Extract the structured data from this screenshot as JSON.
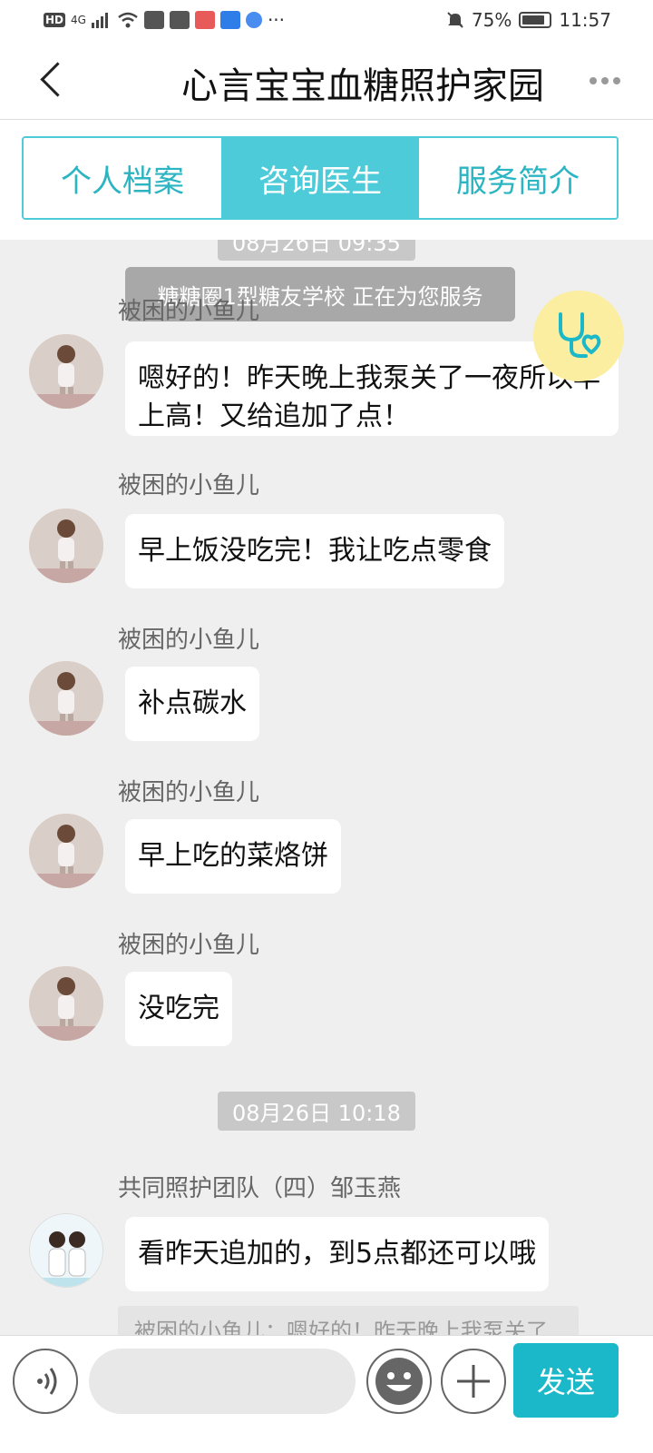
{
  "status_bar": {
    "network": "HD",
    "signal": "4G",
    "battery": "75%",
    "time": "11:57",
    "more": "···"
  },
  "header": {
    "title": "心言宝宝血糖照护家园"
  },
  "tabs": [
    {
      "label": "个人档案",
      "active": false
    },
    {
      "label": "咨询医生",
      "active": true
    },
    {
      "label": "服务简介",
      "active": false
    }
  ],
  "chat": {
    "top_time": "08月26日 09:35",
    "system_notice": "糖糖圈1型糖友学校 正在为您服务",
    "messages": [
      {
        "sender": "被困的小鱼儿",
        "text": "嗯好的！昨天晚上我泵关了一夜所以早上高！又给追加了点！"
      },
      {
        "sender": "被困的小鱼儿",
        "text": "早上饭没吃完！我让吃点零食"
      },
      {
        "sender": "被困的小鱼儿",
        "text": "补点碳水"
      },
      {
        "sender": "被困的小鱼儿",
        "text": "早上吃的菜烙饼"
      },
      {
        "sender": "被困的小鱼儿",
        "text": "没吃完"
      }
    ],
    "second_time": "08月26日 10:18",
    "doctor_message": {
      "sender": "共同照护团队（四）邹玉燕",
      "text": "看昨天追加的，到5点都还可以哦",
      "quote": "被困的小鱼儿：嗯好的！昨天晚上我泵关了"
    }
  },
  "input_bar": {
    "send_label": "发送"
  },
  "colors": {
    "accent": "#4ecbd8",
    "send": "#1ab8c8",
    "fab": "#fbeea0"
  }
}
